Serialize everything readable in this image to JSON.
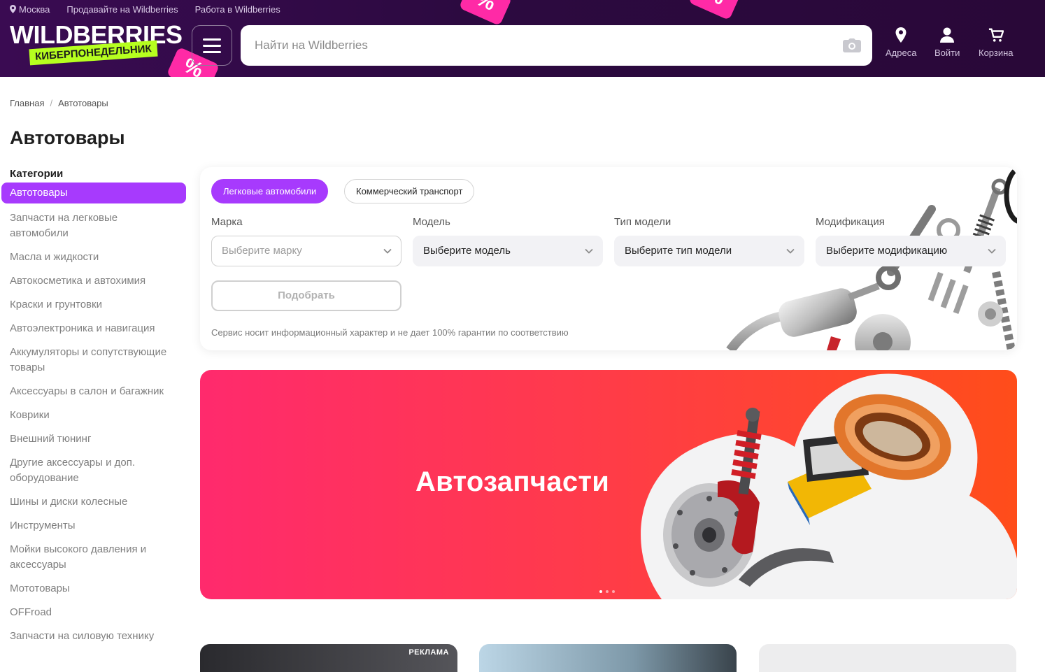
{
  "header": {
    "city": "Москва",
    "sell_link": "Продавайте на Wildberries",
    "work_link": "Работа в Wildberries",
    "logo_text": "WILDBERRIES",
    "promo_text": "КИБЕРПОНЕДЕЛЬНИК",
    "search_placeholder": "Найти на Wildberries",
    "nav": {
      "addresses": "Адреса",
      "login": "Войти",
      "cart": "Корзина"
    },
    "colors": {
      "bg": "#2c0a40",
      "promo": "#b6ff1f",
      "tag": "#ff2aa6"
    }
  },
  "breadcrumb": {
    "home": "Главная",
    "separator": "/",
    "current": "Автотовары"
  },
  "page": {
    "title": "Автотовары"
  },
  "sidebar": {
    "heading": "Категории",
    "items": [
      {
        "label": "Автотовары",
        "active": true
      },
      {
        "label": "Запчасти на легковые автомобили"
      },
      {
        "label": "Масла и жидкости"
      },
      {
        "label": "Автокосметика и автохимия"
      },
      {
        "label": "Краски и грунтовки"
      },
      {
        "label": "Автоэлектроника и навигация"
      },
      {
        "label": "Аккумуляторы и сопутствующие товары"
      },
      {
        "label": "Аксессуары в салон и багажник"
      },
      {
        "label": "Коврики"
      },
      {
        "label": "Внешний тюнинг"
      },
      {
        "label": "Другие аксессуары и доп. оборудование"
      },
      {
        "label": "Шины и диски колесные"
      },
      {
        "label": "Инструменты"
      },
      {
        "label": "Мойки высокого давления и аксессуары"
      },
      {
        "label": "Мототовары"
      },
      {
        "label": "OFFroad"
      },
      {
        "label": "Запчасти на силовую технику"
      }
    ],
    "accent": "#a73afd"
  },
  "filter": {
    "tabs": [
      "Легковые автомобили",
      "Коммерческий транспорт"
    ],
    "active_tab": 0,
    "fields": [
      {
        "label": "Марка",
        "placeholder": "Выберите марку"
      },
      {
        "label": "Модель",
        "placeholder": "Выберите модель"
      },
      {
        "label": "Тип модели",
        "placeholder": "Выберите тип модели"
      },
      {
        "label": "Модификация",
        "placeholder": "Выберите модификацию"
      }
    ],
    "submit_label": "Подобрать",
    "disclaimer": "Сервис носит информационный характер и не дает 100% гарантии по соответствию"
  },
  "banner": {
    "title": "Автозапчасти",
    "slide_count": 3,
    "current_slide": 1
  },
  "bottom_cards": {
    "ad_label": "РЕКЛАМА"
  }
}
